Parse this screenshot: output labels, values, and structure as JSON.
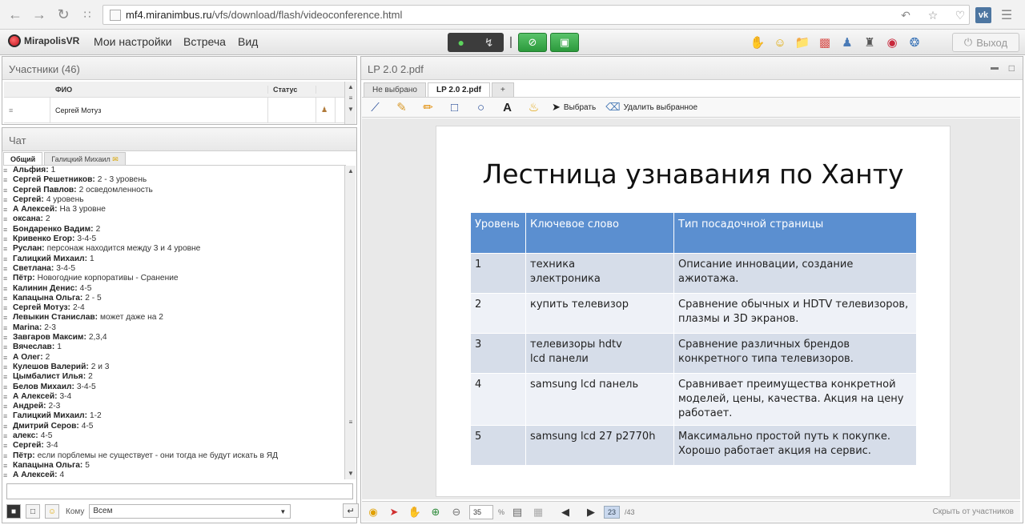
{
  "browser": {
    "url_host": "mf4.miranimbus.ru",
    "url_path": "/vfs/download/flash/videoconference.html",
    "vk_badge": "vk"
  },
  "app": {
    "logo": "MirapolisVR",
    "menu": [
      "Мои настройки",
      "Встреча",
      "Вид"
    ],
    "exit_label": "Выход"
  },
  "participants": {
    "title": "Участники (46)",
    "columns": [
      "ФИО",
      "Статус"
    ],
    "rows": [
      {
        "name": "Сергей Мотуз"
      }
    ]
  },
  "chat": {
    "title": "Чат",
    "tabs": [
      "Общий",
      "Галицкий Михаил"
    ],
    "messages": [
      {
        "author": "Альфия:",
        "text": "1"
      },
      {
        "author": "Сергей Решетников:",
        "text": "2 - 3 уровень"
      },
      {
        "author": "Сергей  Павлов:",
        "text": "2 осведомленность"
      },
      {
        "author": "Сергей:",
        "text": "4 уровень"
      },
      {
        "author": "А Алексей:",
        "text": "На 3 уровне"
      },
      {
        "author": "оксана:",
        "text": "2"
      },
      {
        "author": "Бондаренко Вадим:",
        "text": "2"
      },
      {
        "author": "Кривенко Егор:",
        "text": "3-4-5"
      },
      {
        "author": "Руслан:",
        "text": "персонаж находится между 3 и 4 уровне"
      },
      {
        "author": "Галицкий Михаил:",
        "text": "1"
      },
      {
        "author": "Светлана:",
        "text": "3-4-5"
      },
      {
        "author": "Пётр:",
        "text": "Новогодние корпоративы - Сранение"
      },
      {
        "author": "Калинин Денис:",
        "text": "4-5"
      },
      {
        "author": "Капацына Ольга:",
        "text": "2 - 5"
      },
      {
        "author": "Сергей Мотуз:",
        "text": "2-4"
      },
      {
        "author": "Левыкин Станислав:",
        "text": "может даже на 2"
      },
      {
        "author": "Marina:",
        "text": "2-3"
      },
      {
        "author": "Завгаров Максим:",
        "text": "2,3,4"
      },
      {
        "author": "Вячеслав:",
        "text": "1"
      },
      {
        "author": "А Олег:",
        "text": "2"
      },
      {
        "author": "Кулешов  Валерий:",
        "text": "2 и 3"
      },
      {
        "author": "Цымбалист Илья:",
        "text": "2"
      },
      {
        "author": "Белов Михаил:",
        "text": "3-4-5"
      },
      {
        "author": "А Алексей:",
        "text": "3-4"
      },
      {
        "author": "Андрей:",
        "text": "2-3"
      },
      {
        "author": "Галицкий Михаил:",
        "text": "1-2"
      },
      {
        "author": "Дмитрий Серов:",
        "text": "4-5"
      },
      {
        "author": "алекс:",
        "text": "4-5"
      },
      {
        "author": "Сергей:",
        "text": "3-4"
      },
      {
        "author": "Пётр:",
        "text": "если порблемы не существует - они тогда не будут искать в ЯД"
      },
      {
        "author": "Капацына Ольга:",
        "text": "5"
      },
      {
        "author": "А Алексей:",
        "text": "4"
      }
    ],
    "to_label": "Кому",
    "to_value": "Всем"
  },
  "presentation": {
    "title": "LP 2.0 2.pdf",
    "tabs": [
      "Не выбрано",
      "LP 2.0 2.pdf",
      "+"
    ],
    "tools": {
      "select": "Выбрать",
      "delete": "Удалить выбранное"
    },
    "slide": {
      "title": "Лестница узнавания по Ханту",
      "headers": [
        "Уровень",
        "Ключевое слово",
        "Тип посадочной страницы"
      ],
      "rows": [
        {
          "level": "1",
          "keyword_1": "техника",
          "keyword_2": "электроника",
          "page_type": "Описание инновации, создание ажиотажа."
        },
        {
          "level": "2",
          "keyword_1": "купить телевизор",
          "keyword_2": "",
          "page_type": "Сравнение обычных и HDTV телевизоров, плазмы и 3D экранов."
        },
        {
          "level": "3",
          "keyword_1": "телевизоры hdtv",
          "keyword_2": "lcd панели",
          "page_type": "Сравнение различных брендов конкретного типа телевизоров."
        },
        {
          "level": "4",
          "keyword_1": "samsung lcd панель",
          "keyword_2": "",
          "page_type": "Сравнивает преимущества конкретной моделей, цены, качества. Акция на цену работает."
        },
        {
          "level": "5",
          "keyword_1": "samsung lcd 27 p2770h",
          "keyword_2": "",
          "page_type": "Максимально простой путь к покупке. Хорошо работает акция на сервис."
        }
      ]
    },
    "zoom_value": "35",
    "zoom_unit": "%",
    "page_current": "23",
    "page_total": "/43",
    "hide_label": "Скрыть от участников"
  }
}
